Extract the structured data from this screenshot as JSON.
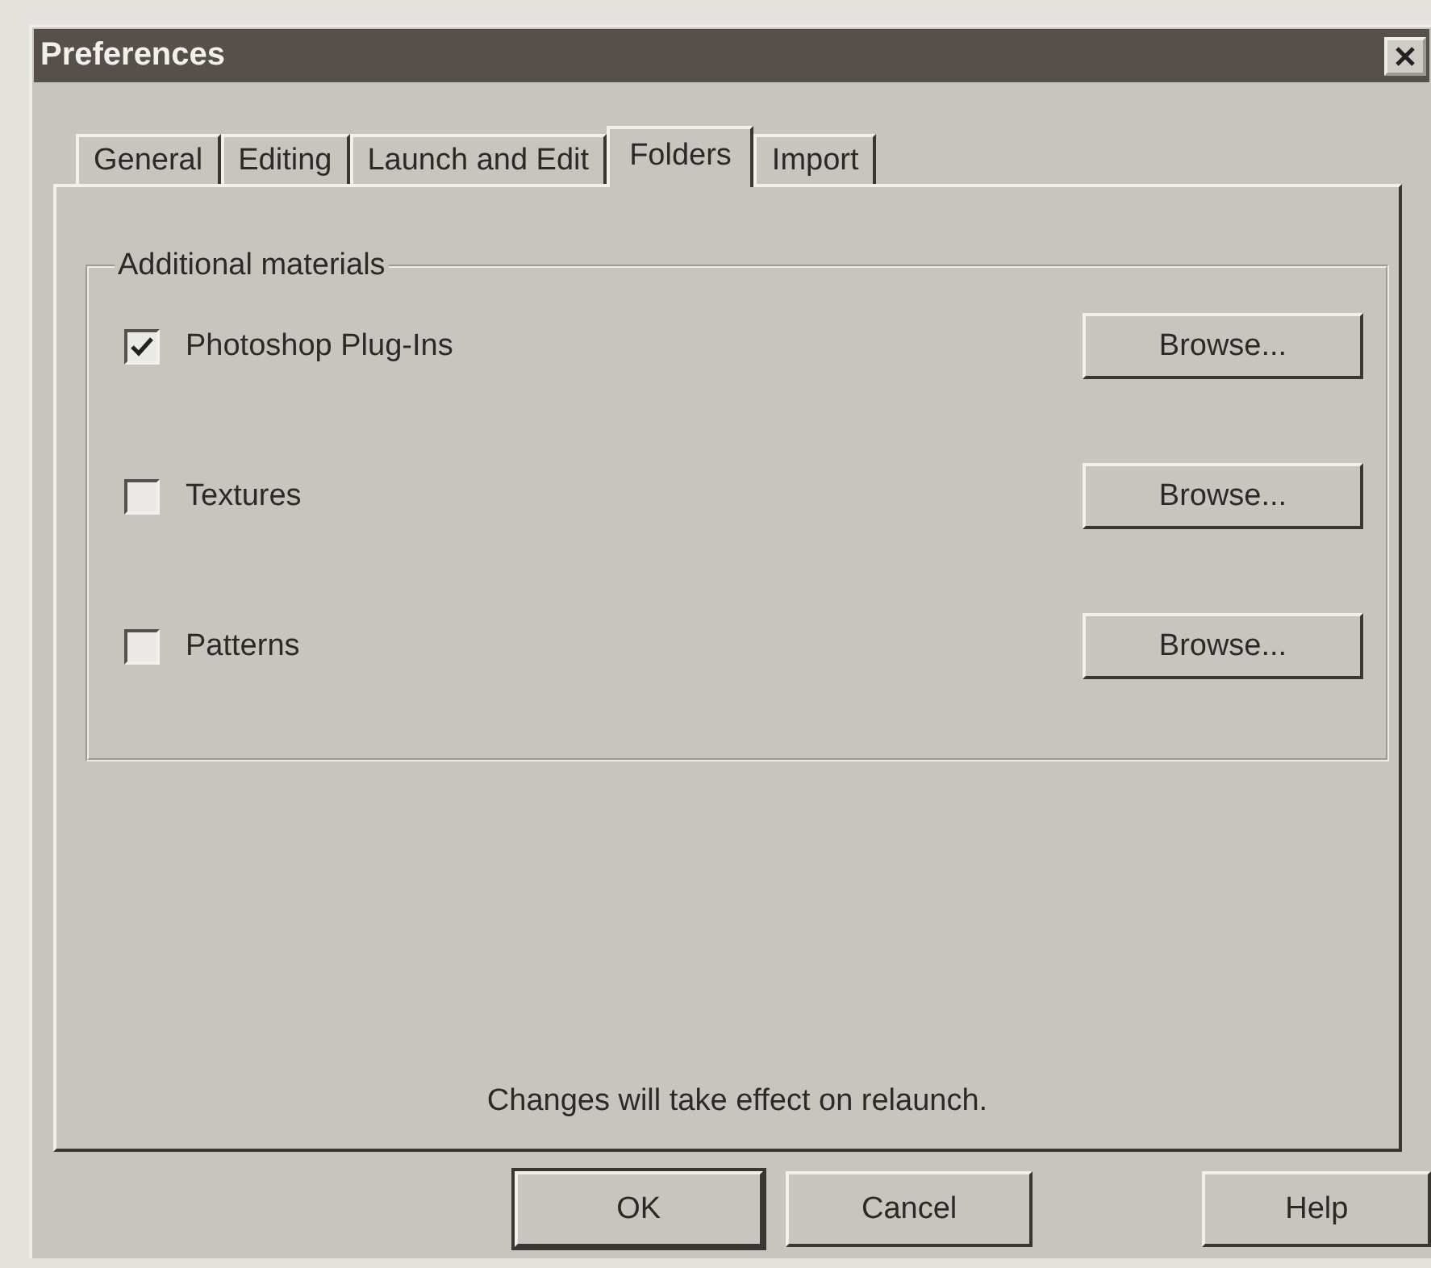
{
  "window": {
    "title": "Preferences"
  },
  "tabs": [
    {
      "label": "General",
      "selected": false
    },
    {
      "label": "Editing",
      "selected": false
    },
    {
      "label": "Launch and Edit",
      "selected": false
    },
    {
      "label": "Folders",
      "selected": true
    },
    {
      "label": "Import",
      "selected": false
    }
  ],
  "group": {
    "title": "Additional materials",
    "rows": [
      {
        "label": "Photoshop Plug-Ins",
        "checked": true,
        "button": "Browse..."
      },
      {
        "label": "Textures",
        "checked": false,
        "button": "Browse..."
      },
      {
        "label": "Patterns",
        "checked": false,
        "button": "Browse..."
      }
    ]
  },
  "note": "Changes will take effect on relaunch.",
  "buttons": [
    {
      "label": "OK",
      "default": true
    },
    {
      "label": "Cancel",
      "default": false
    },
    {
      "label": "Help",
      "default": false
    }
  ]
}
